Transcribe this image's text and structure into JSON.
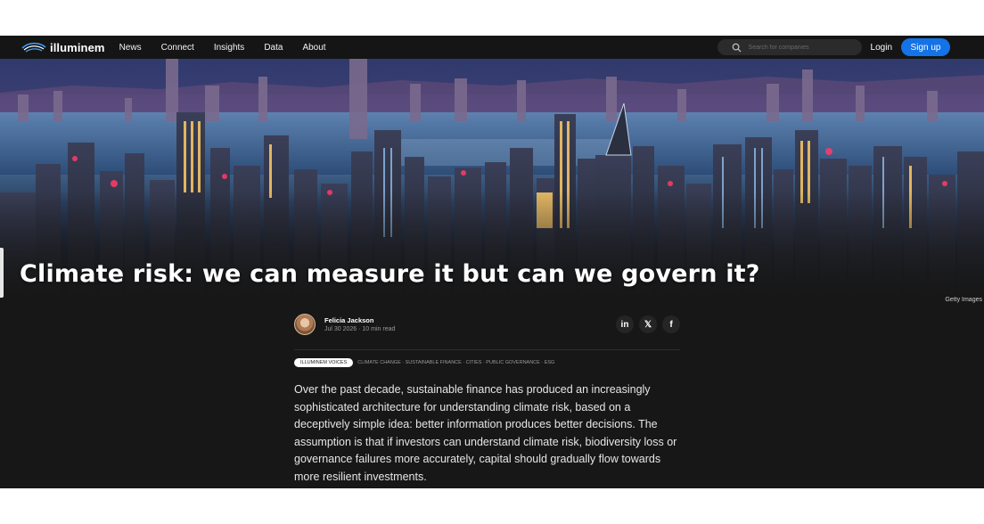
{
  "nav": {
    "brand": "illuminem",
    "links": [
      "News",
      "Connect",
      "Insights",
      "Data",
      "About"
    ],
    "search_placeholder": "Search for companies",
    "login_label": "Login",
    "signup_label": "Sign up"
  },
  "hero": {
    "title": "Climate risk: we can measure it but can we govern it?",
    "credit": "Getty Images"
  },
  "article": {
    "author_name": "Felicia Jackson",
    "date_read": "Jul 30 2026 · 10 min read",
    "share_icons": [
      "linkedin-icon",
      "x-icon",
      "facebook-icon"
    ],
    "share_glyphs": [
      "in",
      "𝕏",
      "f"
    ],
    "tag_pill": "ILLUMINEM VOICES",
    "tag_list": "CLIMATE CHANGE · SUSTAINABLE FINANCE · CITIES · PUBLIC GOVERNANCE · ESG",
    "body": "Over the past decade, sustainable finance has produced an increasingly sophisticated architecture for understanding climate risk, based on a deceptively simple idea: better information produces better decisions. The assumption is that if investors can understand climate risk, biodiversity loss or governance failures more accurately, capital should gradually flow towards more resilient investments."
  },
  "colors": {
    "nav_bg": "#151515",
    "page_bg": "#171717",
    "accent": "#1473e6"
  }
}
